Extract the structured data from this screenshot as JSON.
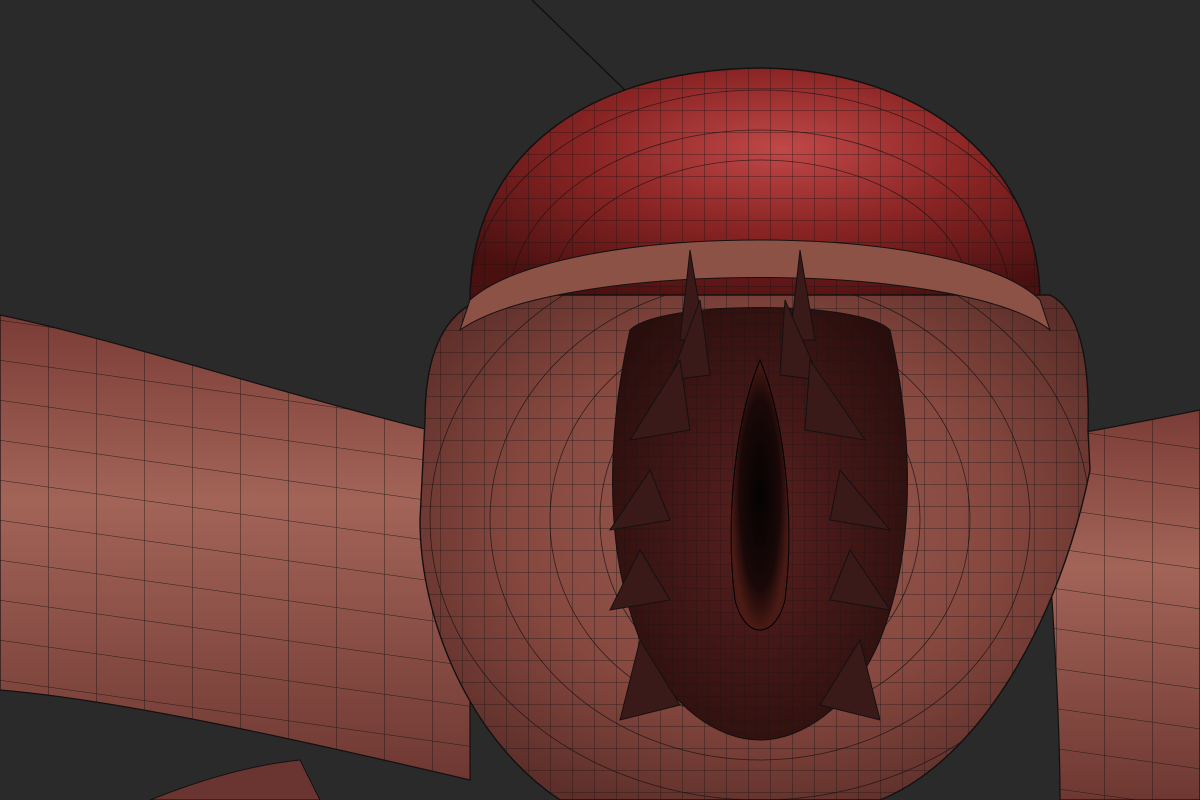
{
  "viewport": {
    "background": "#2a2a2a",
    "shading": "solid-with-wireframe"
  },
  "model": {
    "flesh_color": "#8a4a42",
    "flesh_highlight": "#b97a6e",
    "cap_color": "#7a1f1e",
    "cap_highlight": "#c25050",
    "wire_color": "#141010",
    "cavity_color": "#0b0606",
    "spine_count": 12
  }
}
